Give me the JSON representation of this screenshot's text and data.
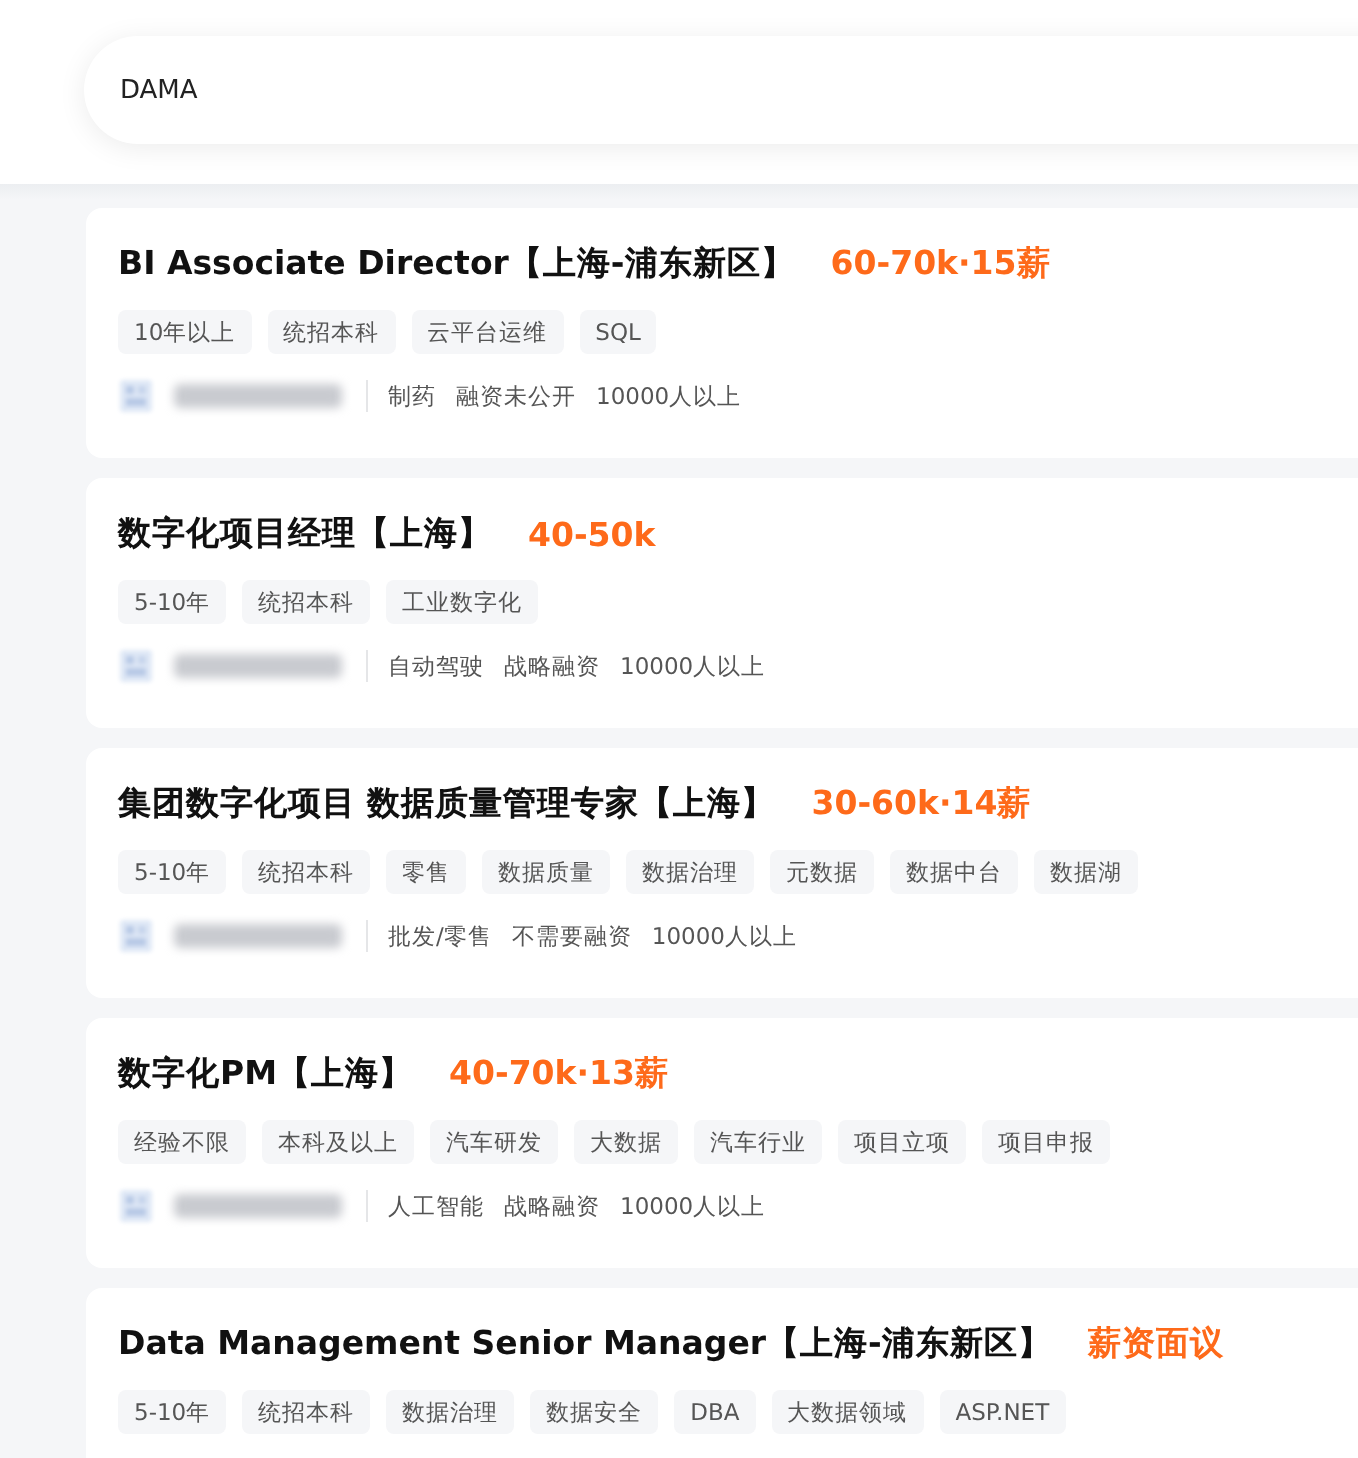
{
  "search": {
    "value": "DAMA"
  },
  "jobs": [
    {
      "title": "BI Associate Director【上海-浦东新区】",
      "salary": "60-70k·15薪",
      "tags": [
        "10年以上",
        "统招本科",
        "云平台运维",
        "SQL"
      ],
      "company_info": [
        "制药",
        "融资未公开",
        "10000人以上"
      ]
    },
    {
      "title": "数字化项目经理【上海】",
      "salary": "40-50k",
      "tags": [
        "5-10年",
        "统招本科",
        "工业数字化"
      ],
      "company_info": [
        "自动驾驶",
        "战略融资",
        "10000人以上"
      ]
    },
    {
      "title": "集团数字化项目 数据质量管理专家【上海】",
      "salary": "30-60k·14薪",
      "tags": [
        "5-10年",
        "统招本科",
        "零售",
        "数据质量",
        "数据治理",
        "元数据",
        "数据中台",
        "数据湖"
      ],
      "company_info": [
        "批发/零售",
        "不需要融资",
        "10000人以上"
      ]
    },
    {
      "title": "数字化PM【上海】",
      "salary": "40-70k·13薪",
      "tags": [
        "经验不限",
        "本科及以上",
        "汽车研发",
        "大数据",
        "汽车行业",
        "项目立项",
        "项目申报"
      ],
      "company_info": [
        "人工智能",
        "战略融资",
        "10000人以上"
      ]
    },
    {
      "title": "Data Management Senior Manager【上海-浦东新区】",
      "salary": "薪资面议",
      "tags": [
        "5-10年",
        "统招本科",
        "数据治理",
        "数据安全",
        "DBA",
        "大数据领域",
        "ASP.NET"
      ]
    }
  ]
}
